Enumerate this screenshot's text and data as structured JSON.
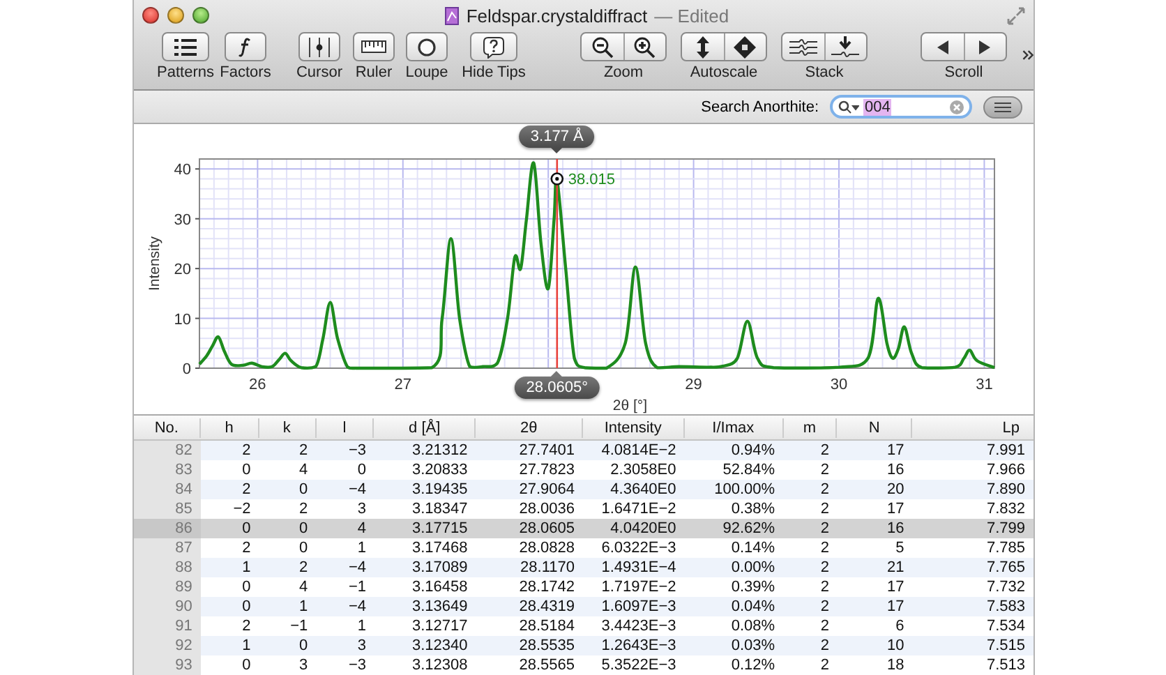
{
  "window": {
    "document": "Feldspar.crystaldiffract",
    "status": "— Edited"
  },
  "toolbar": [
    {
      "label": "Patterns",
      "kind": "single"
    },
    {
      "label": "Factors",
      "kind": "single"
    },
    {
      "label": "Cursor",
      "kind": "single"
    },
    {
      "label": "Ruler",
      "kind": "single"
    },
    {
      "label": "Loupe",
      "kind": "single"
    },
    {
      "label": "Hide Tips",
      "kind": "single"
    },
    {
      "label": "Zoom",
      "kind": "segmented"
    },
    {
      "label": "Autoscale",
      "kind": "segmented"
    },
    {
      "label": "Stack",
      "kind": "segmented"
    },
    {
      "label": "Scroll",
      "kind": "segmented"
    }
  ],
  "search": {
    "label": "Search Anorthite:",
    "value": "004"
  },
  "chart": {
    "cursor": {
      "top_label": "3.177 Å"
    },
    "chart_data": {
      "type": "line",
      "grid": true,
      "ref_lines": [
        {
          "axis": "x",
          "value": 28.0605,
          "label": "28.0605°",
          "color": "#e8413a"
        }
      ],
      "xlabel": "2θ [°]",
      "ylabel": "Intensity",
      "xlim": [
        25.6,
        31.07
      ],
      "ylim": [
        0,
        42
      ],
      "xticks": [
        26,
        27,
        29,
        30,
        31
      ],
      "yticks": [
        0,
        10,
        20,
        30,
        40
      ],
      "x": [
        25.6,
        25.65,
        25.69,
        25.73,
        25.77,
        25.82,
        25.9,
        25.96,
        26.03,
        26.1,
        26.15,
        26.19,
        26.23,
        26.3,
        26.4,
        26.45,
        26.5,
        26.55,
        26.62,
        26.7,
        27.2,
        27.27,
        27.33,
        27.39,
        27.46,
        27.55,
        27.65,
        27.72,
        27.77,
        27.81,
        27.85,
        27.9,
        27.95,
        28.0,
        28.04,
        28.06,
        28.12,
        28.18,
        28.25,
        28.4,
        28.53,
        28.6,
        28.67,
        28.75,
        28.9,
        29.1,
        29.2,
        29.3,
        29.37,
        29.44,
        29.55,
        30.0,
        30.2,
        30.27,
        30.33,
        30.37,
        30.41,
        30.45,
        30.5,
        30.57,
        30.8,
        30.86,
        30.9,
        30.95,
        31.07
      ],
      "series": [
        {
          "color": "#1e8c1e",
          "values": [
            0.8,
            2.5,
            4.5,
            6.3,
            3.5,
            0.8,
            0.6,
            1,
            0.3,
            0.3,
            1.8,
            3,
            1.5,
            0.1,
            0.3,
            6,
            13.2,
            6,
            0.2,
            0,
            0.1,
            10,
            26,
            10,
            0.3,
            0.3,
            1,
            10,
            22.3,
            20,
            30,
            41.2,
            25,
            16,
            30,
            38,
            20,
            2,
            0.1,
            0,
            5,
            20.3,
            5,
            0.1,
            0.3,
            0.2,
            0.4,
            2,
            9.4,
            2,
            0.1,
            0.2,
            2,
            14,
            5,
            2,
            4,
            8.3,
            3,
            0.1,
            0.2,
            2,
            3.6,
            1.5,
            0.1
          ]
        }
      ],
      "annotations": [
        {
          "x": 28.0605,
          "y": 38.015,
          "text": "38.015"
        }
      ]
    }
  },
  "table": {
    "columns": [
      "No.",
      "h",
      "k",
      "l",
      "d [Å]",
      "2θ",
      "Intensity",
      "I/Imax",
      "m",
      "N",
      "Lp"
    ],
    "rows": [
      {
        "cells": [
          "82",
          "2",
          "2",
          "−3",
          "3.21312",
          "27.7401",
          "4.0814E−2",
          "0.94%",
          "2",
          "17",
          "7.991"
        ],
        "selected": false
      },
      {
        "cells": [
          "83",
          "0",
          "4",
          "0",
          "3.20833",
          "27.7823",
          "2.3058E0",
          "52.84%",
          "2",
          "16",
          "7.966"
        ],
        "selected": false
      },
      {
        "cells": [
          "84",
          "2",
          "0",
          "−4",
          "3.19435",
          "27.9064",
          "4.3640E0",
          "100.00%",
          "2",
          "20",
          "7.890"
        ],
        "selected": false
      },
      {
        "cells": [
          "85",
          "−2",
          "2",
          "3",
          "3.18347",
          "28.0036",
          "1.6471E−2",
          "0.38%",
          "2",
          "17",
          "7.832"
        ],
        "selected": false
      },
      {
        "cells": [
          "86",
          "0",
          "0",
          "4",
          "3.17715",
          "28.0605",
          "4.0420E0",
          "92.62%",
          "2",
          "16",
          "7.799"
        ],
        "selected": true
      },
      {
        "cells": [
          "87",
          "2",
          "0",
          "1",
          "3.17468",
          "28.0828",
          "6.0322E−3",
          "0.14%",
          "2",
          "5",
          "7.785"
        ],
        "selected": false
      },
      {
        "cells": [
          "88",
          "1",
          "2",
          "−4",
          "3.17089",
          "28.1170",
          "1.4931E−4",
          "0.00%",
          "2",
          "21",
          "7.765"
        ],
        "selected": false
      },
      {
        "cells": [
          "89",
          "0",
          "4",
          "−1",
          "3.16458",
          "28.1742",
          "1.7197E−2",
          "0.39%",
          "2",
          "17",
          "7.732"
        ],
        "selected": false
      },
      {
        "cells": [
          "90",
          "0",
          "1",
          "−4",
          "3.13649",
          "28.4319",
          "1.6097E−3",
          "0.04%",
          "2",
          "17",
          "7.583"
        ],
        "selected": false
      },
      {
        "cells": [
          "91",
          "2",
          "−1",
          "1",
          "3.12717",
          "28.5184",
          "3.4423E−3",
          "0.08%",
          "2",
          "6",
          "7.534"
        ],
        "selected": false
      },
      {
        "cells": [
          "92",
          "1",
          "0",
          "3",
          "3.12340",
          "28.5535",
          "1.2643E−3",
          "0.03%",
          "2",
          "10",
          "7.515"
        ],
        "selected": false
      },
      {
        "cells": [
          "93",
          "0",
          "3",
          "−3",
          "3.12308",
          "28.5565",
          "5.3522E−3",
          "0.12%",
          "2",
          "18",
          "7.513"
        ],
        "selected": false
      }
    ]
  }
}
